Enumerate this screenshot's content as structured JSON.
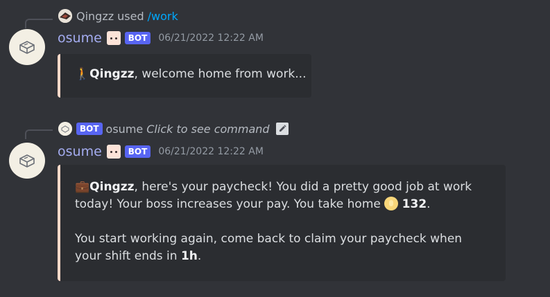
{
  "messages": [
    {
      "reply": {
        "user": "Qingzz",
        "used": "used",
        "command": "/work"
      },
      "author": "osume",
      "bot_tag": "BOT",
      "timestamp": "06/21/2022 12:22 AM",
      "embed": {
        "emoji": "🚶",
        "name": "Qingzz",
        "text": ", welcome home from work..."
      },
      "colors": {
        "accent": "#fcd9c9"
      }
    },
    {
      "reply": {
        "bot_tag": "BOT",
        "author": "osume",
        "prompt": "Click to see command"
      },
      "author": "osume",
      "bot_tag": "BOT",
      "timestamp": "06/21/2022 12:22 AM",
      "embed": {
        "emoji": "💼",
        "name": "Qingzz",
        "text1": ", here's your paycheck! You did a pretty good job at work today! Your boss increases your pay. You take home ",
        "amount": "132",
        "period": ".",
        "text2": "You start working again, come back to claim your paycheck when your shift ends in ",
        "duration": "1h",
        "period2": "."
      },
      "colors": {
        "accent": "#fcd9c9"
      }
    }
  ],
  "icons": [
    "user-avatar-icon",
    "bot-avatar-icon",
    "face-badge-icon",
    "coin-icon",
    "edit-icon"
  ]
}
